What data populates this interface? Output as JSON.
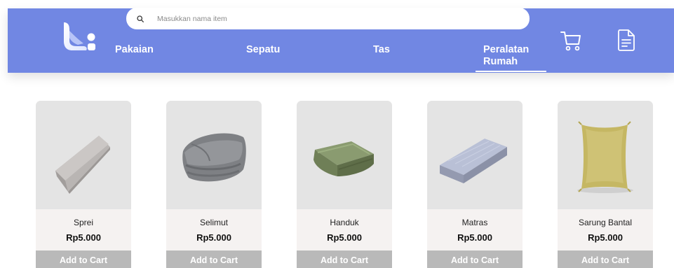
{
  "search": {
    "placeholder": "Masukkan nama item",
    "value": ""
  },
  "nav": {
    "items": [
      {
        "label": "Pakaian"
      },
      {
        "label": "Sepatu"
      },
      {
        "label": "Tas"
      },
      {
        "label": "Peralatan Rumah",
        "active": true
      }
    ]
  },
  "icons": {
    "cart": "cart-icon",
    "orders": "document-icon",
    "search": "search-icon"
  },
  "colors": {
    "navbar": "#7187e3",
    "button": "#b9b9b9",
    "card_bg": "#f5f2f1",
    "image_bg": "#e4e4e4"
  },
  "products": [
    {
      "name": "Sprei",
      "price": "Rp5.000",
      "button": "Add to Cart"
    },
    {
      "name": "Selimut",
      "price": "Rp5.000",
      "button": "Add to Cart"
    },
    {
      "name": "Handuk",
      "price": "Rp5.000",
      "button": "Add to Cart"
    },
    {
      "name": "Matras",
      "price": "Rp5.000",
      "button": "Add to Cart"
    },
    {
      "name": "Sarung Bantal",
      "price": "Rp5.000",
      "button": "Add to Cart"
    }
  ]
}
